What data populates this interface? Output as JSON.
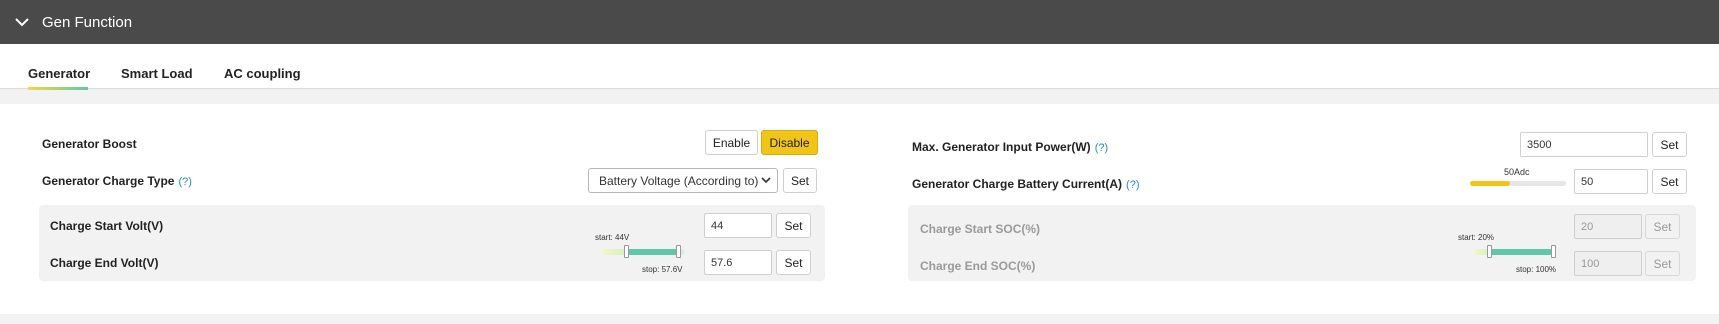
{
  "header": {
    "title": "Gen Function"
  },
  "tabs": [
    {
      "label": "Generator"
    },
    {
      "label": "Smart Load"
    },
    {
      "label": "AC coupling"
    }
  ],
  "left": {
    "boost": {
      "label": "Generator Boost",
      "enable_label": "Enable",
      "disable_label": "Disable",
      "active": "Disable"
    },
    "charge_type": {
      "label": "Generator Charge Type",
      "help": "(?)",
      "value": "Battery Voltage (According to)",
      "set_label": "Set"
    },
    "start_volt": {
      "label": "Charge Start Volt(V)",
      "value": "44",
      "set_label": "Set"
    },
    "end_volt": {
      "label": "Charge End Volt(V)",
      "value": "57.6",
      "set_label": "Set"
    },
    "slider": {
      "start_text": "start: 44V",
      "stop_text": "stop: 57.6V",
      "start_fraction": 0.3,
      "stop_fraction": 0.92
    }
  },
  "right": {
    "max_power": {
      "label": "Max. Generator Input Power(W)",
      "help": "(?)",
      "value": "3500",
      "set_label": "Set"
    },
    "charge_current": {
      "label": "Generator Charge Battery Current(A)",
      "help": "(?)",
      "value": "50",
      "set_label": "Set",
      "bar_text": "50Adc",
      "bar_fraction": 0.42
    },
    "start_soc": {
      "label": "Charge Start SOC(%)",
      "value": "20",
      "set_label": "Set"
    },
    "end_soc": {
      "label": "Charge End SOC(%)",
      "value": "100",
      "set_label": "Set"
    },
    "slider": {
      "start_text": "start: 20%",
      "stop_text": "stop: 100%",
      "start_fraction": 0.2,
      "stop_fraction": 1.0
    }
  },
  "colors": {
    "header_bg": "#4a4a4a",
    "accent_yellow": "#f0c419",
    "accent_green": "#5fc8a8",
    "help_blue": "#1e88e5"
  },
  "icons": {
    "collapse": "chevron-down-icon",
    "select_arrow": "chevron-down-icon"
  }
}
